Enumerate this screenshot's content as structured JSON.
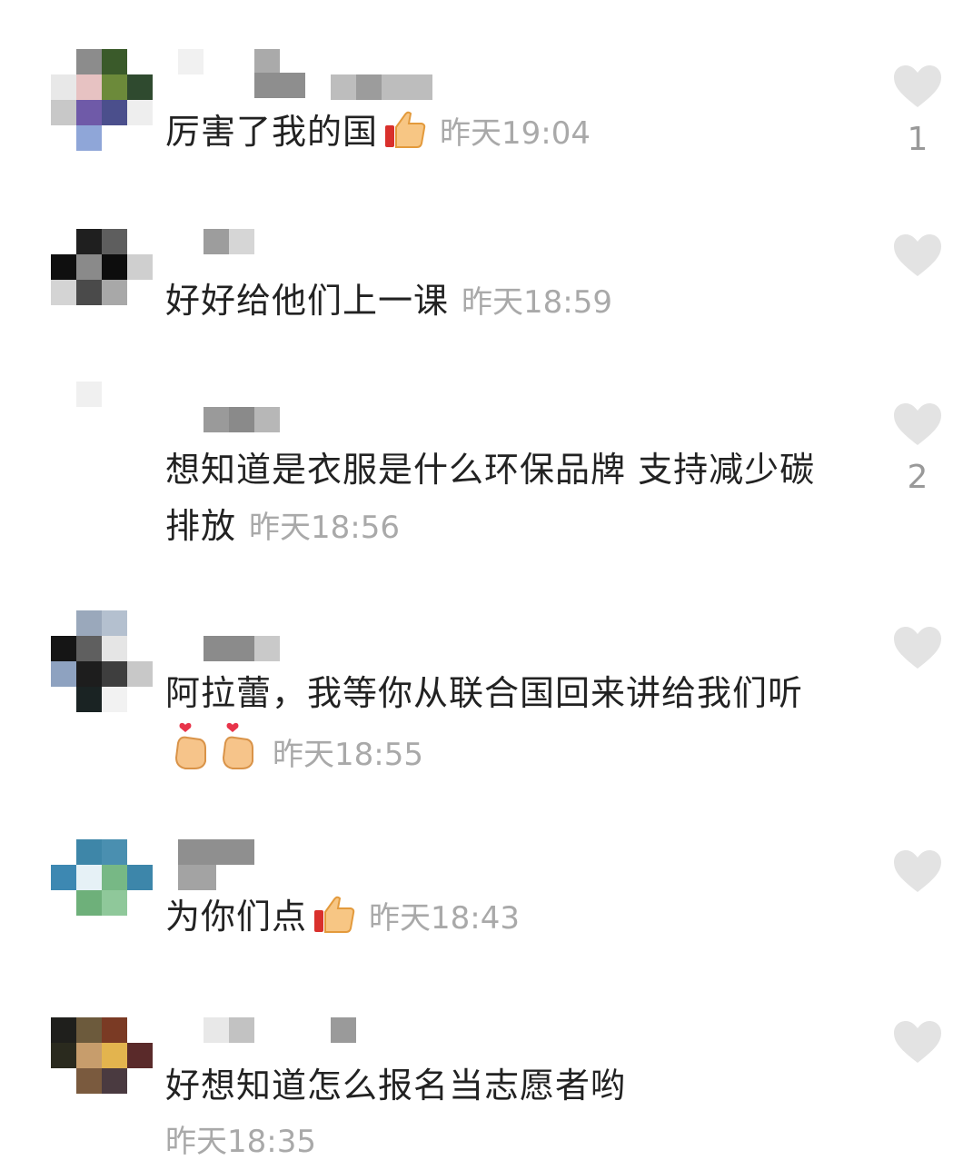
{
  "comments": [
    {
      "text": "厉害了我的国",
      "emoji": [
        "thumbs-up"
      ],
      "time": "昨天19:04",
      "likes": "1",
      "colors": {
        "heart": "#e3e3e3",
        "text": "#222222",
        "time": "#a9a9a9"
      }
    },
    {
      "text": "好好给他们上一课",
      "emoji": [],
      "time": "昨天18:59",
      "likes": ""
    },
    {
      "text": "想知道是衣服是什么环保品牌 支持减少碳排放",
      "emoji": [],
      "time": "昨天18:56",
      "likes": "2"
    },
    {
      "text": "阿拉蕾，我等你从联合国回来讲给我们听",
      "emoji": [
        "finger-heart",
        "finger-heart"
      ],
      "time": "昨天18:55",
      "likes": ""
    },
    {
      "text": "为你们点",
      "emoji": [
        "thumbs-up"
      ],
      "time": "昨天18:43",
      "likes": ""
    },
    {
      "text": "好想知道怎么报名当志愿者哟",
      "emoji": [],
      "time": "昨天18:35",
      "likes": ""
    }
  ]
}
